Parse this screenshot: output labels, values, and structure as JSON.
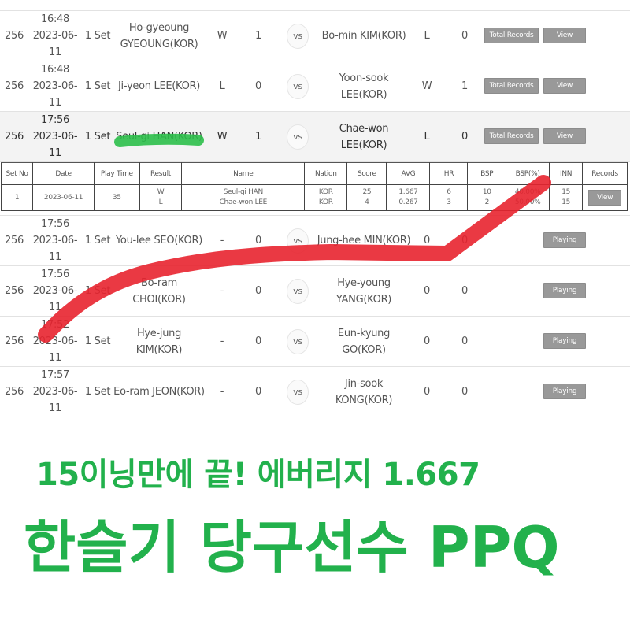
{
  "matches": [
    {
      "no": "256",
      "time": "16:48",
      "date": "2023-06-11",
      "set": "1 Set",
      "player1": [
        "Ho-gyeoung",
        "GYEOUNG(KOR)"
      ],
      "result1": "W",
      "score1": "1",
      "vs": "vs",
      "player2": [
        "Bo-min KIM(KOR)"
      ],
      "result2": "L",
      "score2": "0",
      "buttons": [
        "Total Records",
        "View"
      ]
    },
    {
      "no": "256",
      "time": "16:48",
      "date": "2023-06-11",
      "set": "1 Set",
      "player1": [
        "Ji-yeon LEE(KOR)"
      ],
      "result1": "L",
      "score1": "0",
      "vs": "vs",
      "player2": [
        "Yoon-sook LEE(KOR)"
      ],
      "result2": "W",
      "score2": "1",
      "buttons": [
        "Total Records",
        "View"
      ]
    },
    {
      "no": "256",
      "time": "17:56",
      "date": "2023-06-11",
      "set": "1 Set",
      "player1": [
        "Seul-gi HAN(KOR)"
      ],
      "result1": "W",
      "score1": "1",
      "vs": "vs",
      "player2": [
        "Chae-won LEE(KOR)"
      ],
      "result2": "L",
      "score2": "0",
      "buttons": [
        "Total Records",
        "View"
      ]
    },
    {
      "no": "256",
      "time": "17:56",
      "date": "2023-06-11",
      "set": "1 Set",
      "player1": [
        "You-lee SEO(KOR)"
      ],
      "result1": "-",
      "score1": "0",
      "vs": "vs",
      "player2": [
        "Jung-hee MIN(KOR)"
      ],
      "result2": "0",
      "score2": "0",
      "buttons": [
        "Playing"
      ]
    },
    {
      "no": "256",
      "time": "17:56",
      "date": "2023-06-11",
      "set": "1 Set",
      "player1": [
        "Bo-ram CHOI(KOR)"
      ],
      "result1": "-",
      "score1": "0",
      "vs": "vs",
      "player2": [
        "Hye-young",
        "YANG(KOR)"
      ],
      "result2": "0",
      "score2": "0",
      "buttons": [
        "Playing"
      ]
    },
    {
      "no": "256",
      "time": "17:52",
      "date": "2023-06-11",
      "set": "1 Set",
      "player1": [
        "Hye-jung KIM(KOR)"
      ],
      "result1": "-",
      "score1": "0",
      "vs": "vs",
      "player2": [
        "Eun-kyung GO(KOR)"
      ],
      "result2": "0",
      "score2": "0",
      "buttons": [
        "Playing"
      ]
    },
    {
      "no": "256",
      "time": "17:57",
      "date": "2023-06-11",
      "set": "1 Set",
      "player1": [
        "Eo-ram JEON(KOR)"
      ],
      "result1": "-",
      "score1": "0",
      "vs": "vs",
      "player2": [
        "Jin-sook KONG(KOR)"
      ],
      "result2": "0",
      "score2": "0",
      "buttons": [
        "Playing"
      ]
    }
  ],
  "detail": {
    "headers": [
      "Set No",
      "Date",
      "Play Time",
      "Result",
      "Name",
      "Nation",
      "Score",
      "AVG",
      "HR",
      "BSP",
      "BSP(%)",
      "INN",
      "Records"
    ],
    "row": {
      "set_no": "1",
      "date": "2023-06-11",
      "play_time": "35",
      "result": [
        "W",
        "L"
      ],
      "name": [
        "Seul-gi HAN",
        "Chae-won LEE"
      ],
      "nation": [
        "KOR",
        "KOR"
      ],
      "score": [
        "25",
        "4"
      ],
      "avg": [
        "1.667",
        "0.267"
      ],
      "hr": [
        "6",
        "3"
      ],
      "bsp": [
        "10",
        "2"
      ],
      "bsp_pct": [
        "40.00%",
        "50.00%"
      ],
      "inn": [
        "15",
        "15"
      ],
      "records_button": "View"
    }
  },
  "caption": {
    "line1": "15이닝만에 끝! 에버리지 1.667",
    "line2": "한슬기 당구선수 PPQ"
  },
  "colors": {
    "caption_green": "#22b14c",
    "button_gray": "#999999",
    "highlight_row": "#f3f3f3",
    "red_marker": "#e8232f",
    "green_marker": "#2cbf4a"
  }
}
